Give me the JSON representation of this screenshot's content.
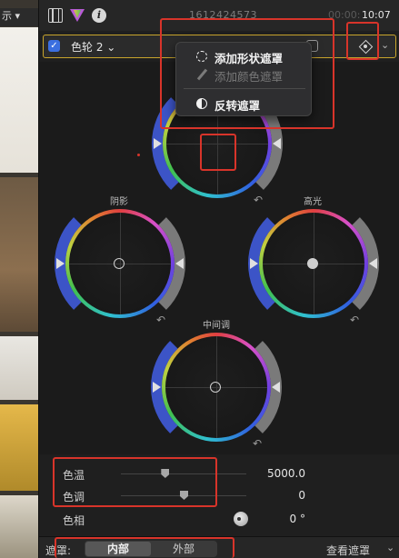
{
  "left_strip": {
    "label": "示 ▾"
  },
  "top_bar": {
    "clip_id": "1612424573",
    "timecode_dim": "00:00:",
    "timecode": "10:07"
  },
  "effect": {
    "checked": "✓",
    "name": "色轮 2 ⌄",
    "chevron": "⌄"
  },
  "mask_menu": {
    "add_shape_mask": "添加形状遮罩",
    "add_color_mask": "添加颜色遮罩",
    "invert_mask": "反转遮罩"
  },
  "wheels": {
    "shadows_label": "阴影",
    "highlights_label": "高光",
    "midtones_label": "中间调",
    "reset_symbol": "↶"
  },
  "params": {
    "temperature": {
      "label": "色温",
      "value": "5000.0",
      "position": 0.35
    },
    "tint": {
      "label": "色调",
      "value": "0",
      "position": 0.5
    },
    "hue": {
      "label": "色相",
      "value": "0 °"
    }
  },
  "bottom_bar": {
    "mask_label": "遮罩:",
    "inside": "内部",
    "outside": "外部",
    "view_mask": "查看遮罩",
    "chevron": "⌄"
  },
  "colors": {
    "annotation_red": "#d8342a",
    "selection_gold": "#c9a52c",
    "checkbox_blue": "#3b6fe0"
  }
}
